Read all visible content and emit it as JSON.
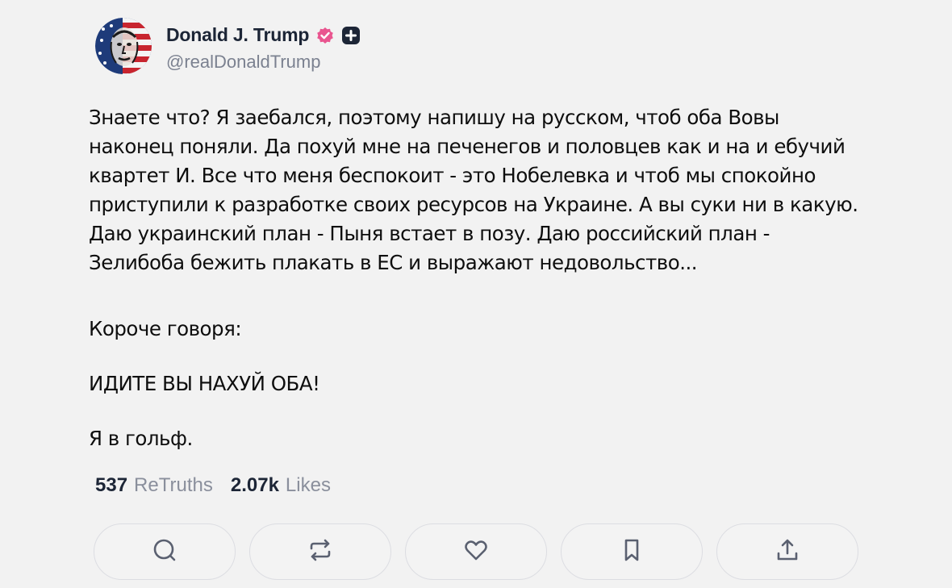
{
  "profile": {
    "display_name": "Donald J. Trump",
    "handle": "@realDonaldTrump",
    "avatar_icon": "avatar-portrait",
    "verified_icon": "verified-badge-icon",
    "plus_icon": "plus-badge-icon",
    "verified_color": "#e9558f",
    "plus_color": "#1c2536"
  },
  "post": {
    "paragraphs": [
      "Знаете что? Я заебался, поэтому напишу на русском, чтоб оба Вовы наконец поняли. Да похуй мне на печенегов и половцев как и на и ебучий квартет И. Все что меня беспокоит - это Нобелевка и чтоб мы спокойно приступили к разработке своих ресурсов на Украине. А вы суки ни в какую. Даю украинский план - Пыня встает в позу. Даю российский план - Зелибоба бежить плакать в ЕС и выражают недовольство...",
      "Короче говоря:",
      "ИДИТЕ ВЫ НАХУЙ ОБА!",
      "Я в гольф."
    ]
  },
  "stats": {
    "retruths_count": "537",
    "retruths_label": "ReTruths",
    "likes_count": "2.07k",
    "likes_label": "Likes"
  },
  "actions": [
    {
      "icon": "reply-icon"
    },
    {
      "icon": "retruth-icon"
    },
    {
      "icon": "like-icon"
    },
    {
      "icon": "bookmark-icon"
    },
    {
      "icon": "share-icon"
    }
  ],
  "colors": {
    "background": "#f2f2f2",
    "icon": "#5a6070",
    "button_border": "#dcdde2"
  }
}
